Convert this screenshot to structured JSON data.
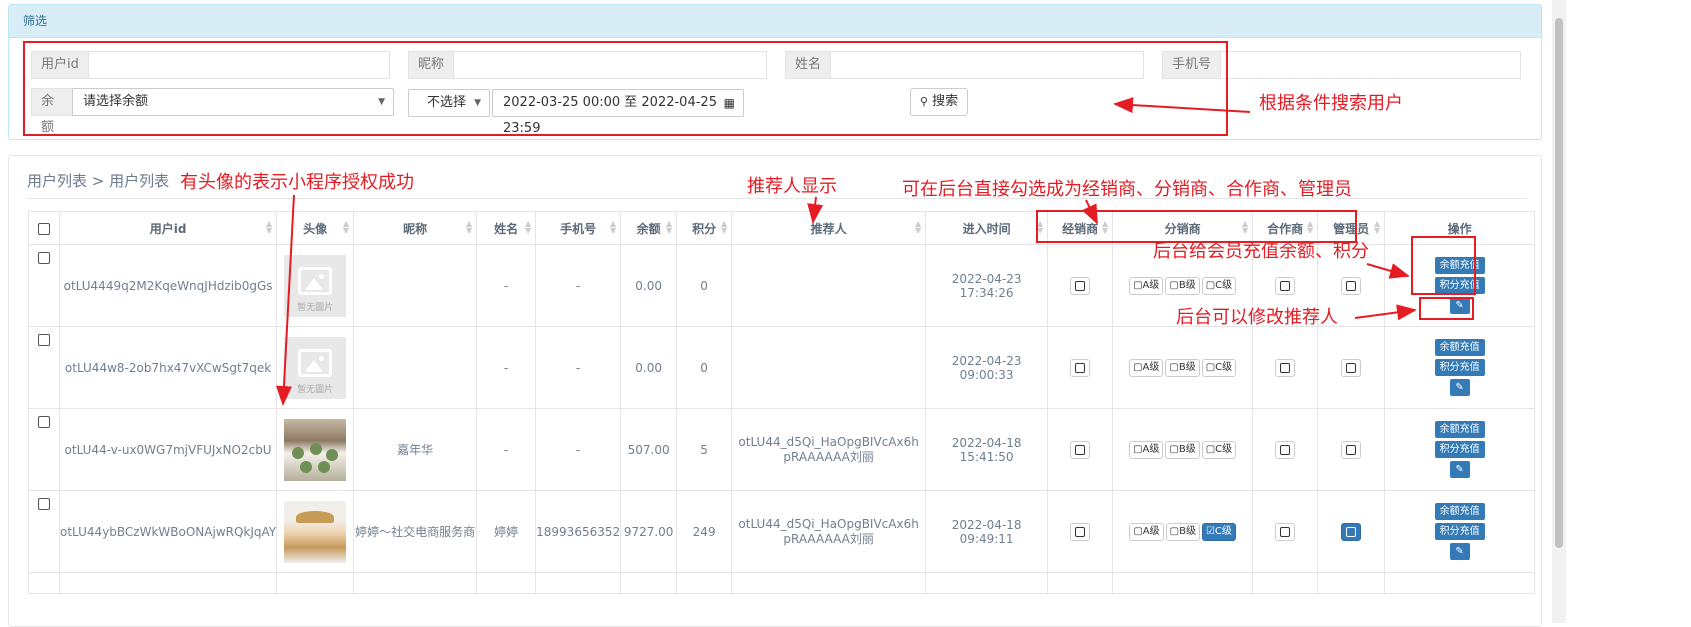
{
  "filter": {
    "header": "筛选",
    "userid_label": "用户id",
    "nickname_label": "昵称",
    "name_label": "姓名",
    "phone_label": "手机号",
    "balance_label": "余额",
    "balance_select": "请选择余额",
    "time_select": "不选择",
    "date_range": "2022-03-25 00:00 至 2022-04-25 23:59",
    "search_button": "搜索"
  },
  "breadcrumb": "用户列表 > 用户列表",
  "table": {
    "headers": [
      "用户id",
      "头像",
      "昵称",
      "姓名",
      "手机号",
      "余额",
      "积分",
      "推荐人",
      "进入时间",
      "经销商",
      "分销商",
      "合作商",
      "管理员",
      "操作"
    ],
    "placeholder_text": "暂无圖片",
    "level_labels": [
      "A级",
      "B级",
      "C级"
    ],
    "recharge_balance": "余额充值",
    "recharge_points": "积分充值",
    "rows": [
      {
        "userid": "otLU4449q2M2KqeWnqJHdzib0gGs",
        "nickname": "",
        "name": "-",
        "phone": "-",
        "balance": "0.00",
        "points": "0",
        "referrer": "",
        "time": "2022-04-23 17:34:26"
      },
      {
        "userid": "otLU44w8-2ob7hx47vXCwSgt7qek",
        "nickname": "",
        "name": "-",
        "phone": "-",
        "balance": "0.00",
        "points": "0",
        "referrer": "",
        "time": "2022-04-23 09:00:33"
      },
      {
        "userid": "otLU44-v-ux0WG7mjVFUJxNO2cbU",
        "nickname": "嘉年华",
        "name": "-",
        "phone": "-",
        "balance": "507.00",
        "points": "5",
        "referrer": "otLU44_d5Qi_HaOpgBIVcAx6hpRAAAAAA刘丽",
        "time": "2022-04-18 15:41:50"
      },
      {
        "userid": "otLU44ybBCzWkWBoONAjwRQkJqAY",
        "nickname": "婷婷～社交电商服务商",
        "name": "婷婷",
        "phone": "18993656352",
        "balance": "9727.00",
        "points": "249",
        "referrer": "otLU44_d5Qi_HaOpgBIVcAx6hpRAAAAAA刘丽",
        "time": "2022-04-18 09:49:11"
      }
    ]
  },
  "annotations": {
    "search": "根据条件搜索用户",
    "avatar": "有头像的表示小程序授权成功",
    "referrer": "推荐人显示",
    "roles": "可在后台直接勾选成为经销商、分销商、合作商、管理员",
    "recharge": "后台给会员充值余额、积分",
    "edit_referrer": "后台可以修改推荐人"
  },
  "colors": {
    "annotation": "#e51c23",
    "primary": "#337ab7",
    "header_bg": "#d9edf7"
  }
}
